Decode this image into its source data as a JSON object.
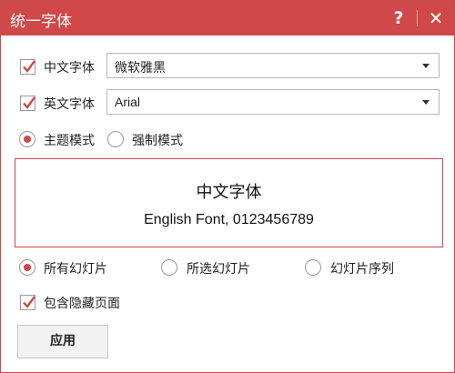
{
  "window": {
    "title": "统一字体",
    "help_label": "?",
    "close_label": "✕"
  },
  "cn_font": {
    "checked": true,
    "label": "中文字体",
    "value": "微软雅黑"
  },
  "en_font": {
    "checked": true,
    "label": "英文字体",
    "value": "Arial"
  },
  "mode": {
    "theme_label": "主题模式",
    "force_label": "强制模式",
    "selected": "theme"
  },
  "preview": {
    "cn_text": "中文字体",
    "en_text": "English Font, 0123456789"
  },
  "scope": {
    "all_label": "所有幻灯片",
    "selected_label": "所选幻灯片",
    "sequence_label": "幻灯片序列",
    "selected": "all"
  },
  "include_hidden": {
    "checked": true,
    "label": "包含隐藏页面"
  },
  "apply_button": "应用",
  "colors": {
    "accent": "#d04848",
    "border": "#b9b9b9"
  }
}
